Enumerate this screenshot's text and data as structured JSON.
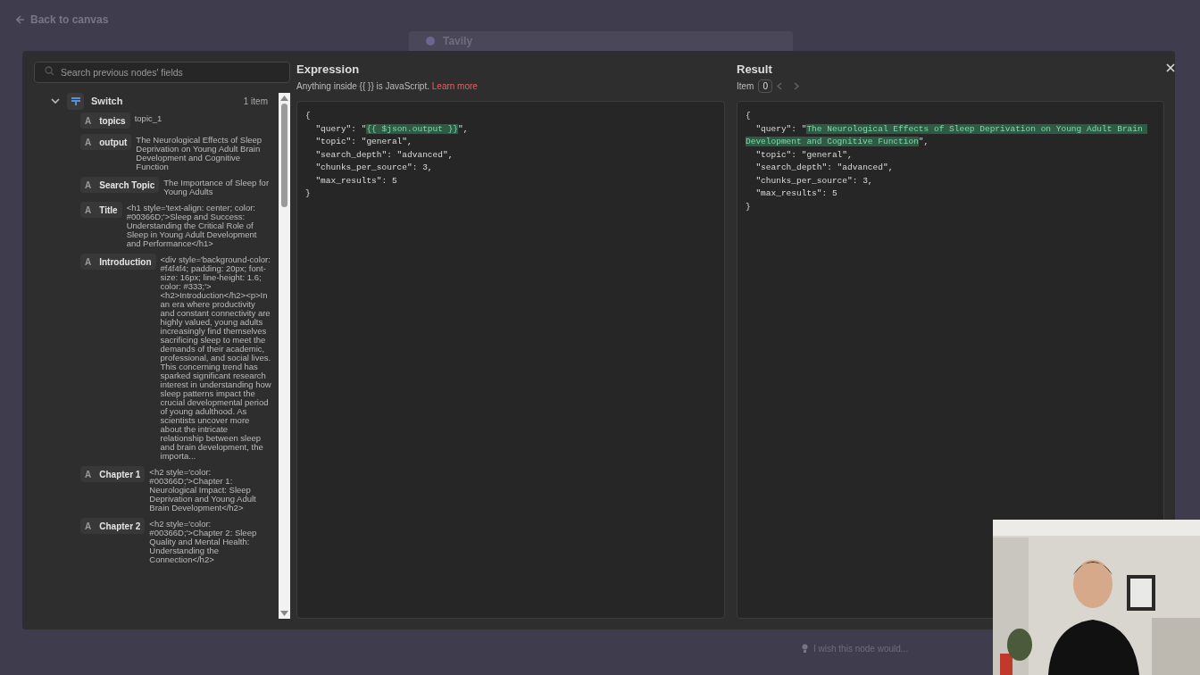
{
  "background": {
    "back_link": "Back to canvas",
    "node_title": "Tavily",
    "feedback_placeholder": "I wish this node would..."
  },
  "search": {
    "placeholder": "Search previous nodes' fields"
  },
  "tree": {
    "node": "Switch",
    "count": "1 item",
    "expanded": true,
    "fields": [
      {
        "type": "A",
        "name": "topics",
        "value": "topic_1"
      },
      {
        "type": "A",
        "name": "output",
        "value": "The Neurological Effects of Sleep Deprivation on Young Adult Brain Development and Cognitive Function"
      },
      {
        "type": "A",
        "name": "Search Topic",
        "value": "The Importance of Sleep for Young Adults"
      },
      {
        "type": "A",
        "name": "Title",
        "value": "<h1 style='text-align: center; color: #00366D;'>Sleep and Success: Understanding the Critical Role of Sleep in Young Adult Development and Performance</h1>"
      },
      {
        "type": "A",
        "name": "Introduction",
        "value": "<div style='background-color: #f4f4f4; padding: 20px; font-size: 16px; line-height: 1.6; color: #333;'><h2>Introduction</h2><p>In an era where productivity and constant connectivity are highly valued, young adults increasingly find themselves sacrificing sleep to meet the demands of their academic, professional, and social lives. This concerning trend has sparked significant research interest in understanding how sleep patterns impact the crucial developmental period of young adulthood. As scientists uncover more about the intricate relationship between sleep and brain development, the importa..."
      },
      {
        "type": "A",
        "name": "Chapter 1",
        "value": "<h2 style='color: #00366D;'>Chapter 1: Neurological Impact: Sleep Deprivation and Young Adult Brain Development</h2>"
      },
      {
        "type": "A",
        "name": "Chapter 2",
        "value": "<h2 style='color: #00366D;'>Chapter 2: Sleep Quality and Mental Health: Understanding the Connection</h2>"
      }
    ]
  },
  "expression": {
    "title": "Expression",
    "hint": "Anything inside {{  }} is JavaScript.",
    "link": "Learn more",
    "segments": [
      {
        "text": "{\n  \"query\": \"",
        "highlighted": false
      },
      {
        "text": "{{ $json.output }}",
        "highlighted": true
      },
      {
        "text": "\",\n  \"topic\": \"general\",\n  \"search_depth\": \"advanced\",\n  \"chunks_per_source\": 3,\n  \"max_results\": 5\n}",
        "highlighted": false
      }
    ]
  },
  "result": {
    "title": "Result",
    "item_label": "Item",
    "item_index": "0",
    "segments": [
      {
        "text": "{\n  \"query\": \"",
        "highlighted": false
      },
      {
        "text": "The Neurological Effects of Sleep Deprivation on Young Adult Brain Development and Cognitive Function",
        "highlighted": true
      },
      {
        "text": "\",\n  \"topic\": \"general\",\n  \"search_depth\": \"advanced\",\n  \"chunks_per_source\": 3,\n  \"max_results\": 5\n}",
        "highlighted": false
      }
    ]
  }
}
